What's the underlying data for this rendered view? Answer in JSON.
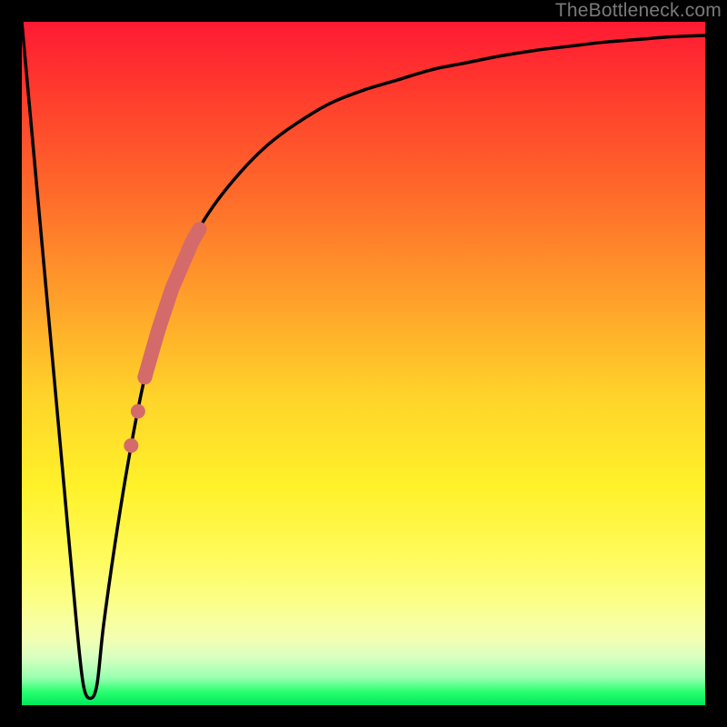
{
  "attribution": "TheBottleneck.com",
  "colors": {
    "frame": "#000000",
    "curve": "#000000",
    "highlight": "#d46a6a",
    "gradient_top": "#ff1a33",
    "gradient_bottom": "#00e85a"
  },
  "chart_data": {
    "type": "line",
    "title": "",
    "xlabel": "",
    "ylabel": "",
    "xlim": [
      0,
      100
    ],
    "ylim": [
      0,
      100
    ],
    "grid": false,
    "legend": false,
    "series": [
      {
        "name": "bottleneck-curve",
        "x": [
          0,
          2,
          4,
          6,
          8,
          9,
          10,
          11,
          12,
          14,
          16,
          18,
          20,
          22,
          25,
          28,
          32,
          36,
          40,
          45,
          50,
          55,
          60,
          65,
          70,
          75,
          80,
          85,
          90,
          95,
          100
        ],
        "y": [
          100,
          78,
          56,
          34,
          12,
          3,
          1,
          3,
          12,
          26,
          38,
          48,
          55,
          61,
          68,
          73,
          78,
          82,
          85,
          88,
          90,
          91.5,
          93,
          94,
          95,
          95.8,
          96.4,
          97,
          97.4,
          97.8,
          98
        ]
      }
    ],
    "highlight_segment": {
      "series": "bottleneck-curve",
      "x_start": 18,
      "x_end": 26,
      "style": "thick-stroke"
    },
    "highlight_points": {
      "series": "bottleneck-curve",
      "x": [
        16,
        17,
        18
      ],
      "style": "dot"
    }
  }
}
